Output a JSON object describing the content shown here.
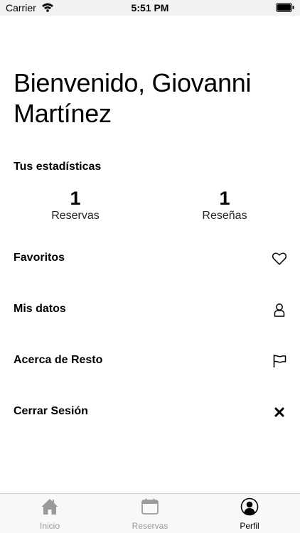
{
  "status_bar": {
    "carrier": "Carrier",
    "time": "5:51 PM"
  },
  "header": {
    "greeting": "Bienvenido, Giovanni Martínez"
  },
  "stats": {
    "title": "Tus estadísticas",
    "items": [
      {
        "value": "1",
        "label": "Reservas"
      },
      {
        "value": "1",
        "label": "Reseñas"
      }
    ]
  },
  "menu": {
    "items": [
      {
        "label": "Favoritos",
        "icon": "heart-icon"
      },
      {
        "label": "Mis datos",
        "icon": "person-icon"
      },
      {
        "label": "Acerca de Resto",
        "icon": "flag-icon"
      },
      {
        "label": "Cerrar Sesión",
        "icon": "close-icon"
      }
    ]
  },
  "tab_bar": {
    "active": "Perfil",
    "tabs": [
      {
        "label": "Inicio",
        "icon": "home-icon"
      },
      {
        "label": "Reservas",
        "icon": "calendar-icon"
      },
      {
        "label": "Perfil",
        "icon": "profile-icon"
      }
    ]
  },
  "colors": {
    "inactive_tab": "#9a9a9a",
    "active_tab": "#000000"
  }
}
